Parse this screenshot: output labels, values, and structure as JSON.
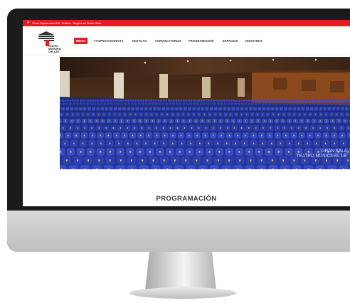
{
  "site": {
    "address": "18 de Septiembre 590, Chillán · Región de Ñuble Chile",
    "logo_lines": [
      "TEATRO",
      "MUNICIPAL",
      "CHILLÁN"
    ],
    "nav": [
      {
        "label": "INICIO",
        "active": true
      },
      {
        "label": "#YOPROTAGONISTA",
        "active": false
      },
      {
        "label": "NOTICIAS",
        "active": false
      },
      {
        "label": "CONVOCATORIAS",
        "active": false
      },
      {
        "label": "PROGRAMACIÓN",
        "active": false
      },
      {
        "label": "ESPACIOS",
        "active": false
      },
      {
        "label": "NOSOTROS",
        "active": false
      }
    ],
    "hero_caption": [
      "GRAN SALA",
      "TEATRO MUNICIPAL DE"
    ],
    "section_title": "PROGRAMACIÓN"
  },
  "colors": {
    "brand_red": "#e41b23",
    "seat_blue": "#3344b8",
    "hall_wood": "#8a4a1e"
  },
  "icons": {
    "location": "map-pin-icon"
  }
}
